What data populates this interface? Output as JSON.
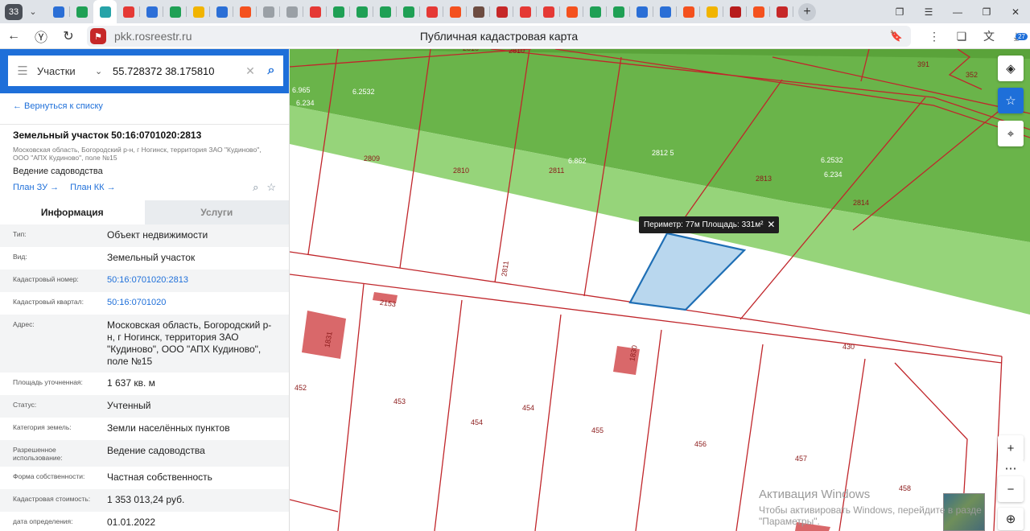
{
  "browser": {
    "tab_count": "33",
    "tab_icon_colors": [
      "#2b6fd6",
      "#1fa055",
      "#27a3a8",
      "#e53935",
      "#2d6fd8",
      "#1fa055",
      "#f1b400",
      "#2b6fd6",
      "#f4511e",
      "#9aa0a6",
      "#9aa0a6",
      "#e53935",
      "#1fa055",
      "#1fa055",
      "#1fa055",
      "#1fa055",
      "#e53935",
      "#f4511e",
      "#6d4c41",
      "#c62828",
      "#e53935",
      "#e53935",
      "#f4511e",
      "#1fa055",
      "#1fa055",
      "#2b6fd6",
      "#2b6fd6",
      "#f4511e",
      "#f1b400",
      "#b71c1c",
      "#f4511e",
      "#c62828"
    ],
    "url": "pkk.rosreestr.ru",
    "page_title": "Публичная кадастровая карта",
    "downloads_badge": "27"
  },
  "search": {
    "type_label": "Участки",
    "query": "55.728372 38.175810"
  },
  "parcel": {
    "back_link": "← Вернуться к списку",
    "title": "Земельный участок 50:16:0701020:2813",
    "address_short": "Московская область, Богородский р-н, г Ногинск, территория ЗАО \"Кудиново\", ООО \"АПХ Кудиново\", поле №15",
    "use": "Ведение садоводства",
    "plan_zu": "План ЗУ →",
    "plan_kk": "План КК →",
    "tabs": {
      "info": "Информация",
      "services": "Услуги"
    },
    "rows": [
      {
        "label": "Тип:",
        "value": "Объект недвижимости"
      },
      {
        "label": "Вид:",
        "value": "Земельный участок"
      },
      {
        "label": "Кадастровый номер:",
        "value": "50:16:0701020:2813"
      },
      {
        "label": "Кадастровый квартал:",
        "value": "50:16:0701020"
      },
      {
        "label": "Адрес:",
        "value": "Московская область, Богородский р-н, г Ногинск, территория ЗАО \"Кудиново\", ООО \"АПХ Кудиново\", поле №15"
      },
      {
        "label": "Площадь уточненная:",
        "value": "1 637 кв. м"
      },
      {
        "label": "Статус:",
        "value": "Учтенный"
      },
      {
        "label": "Категория земель:",
        "value": "Земли населённых пунктов"
      },
      {
        "label": "Разрешенное использование:",
        "value": "Ведение садоводства"
      },
      {
        "label": "Форма собственности:",
        "value": "Частная собственность"
      },
      {
        "label": "Кадастровая стоимость:",
        "value": "1 353 013,24 руб."
      },
      {
        "label": "дата определения:",
        "value": "01.01.2022"
      }
    ]
  },
  "map": {
    "measure_tooltip": "Периметр: 77м Площадь: 331м²",
    "labels": [
      "2810",
      "2810",
      "391",
      "352",
      "6.965",
      "6.234",
      "6.2532",
      "2809",
      "2810",
      "2811",
      "6.862",
      "2812 5",
      "2813",
      "6.2532",
      "6.234",
      "2814",
      "2811",
      "2153",
      "1831",
      "1830",
      "430",
      "452",
      "453",
      "454",
      "454",
      "455",
      "456",
      "457",
      "458"
    ],
    "colors": {
      "green_dark": "#6ab44a",
      "green_light": "#96d47a",
      "boundary": "#c0262b",
      "measure_fill": "#b9d7ee",
      "measure_stroke": "#1f6fb5",
      "building": "#d9686a"
    },
    "watermark_title": "Активация Windows",
    "watermark_text": "Чтобы активировать Windows, перейдите в разде",
    "watermark_text2": "\"Параметры\"."
  }
}
